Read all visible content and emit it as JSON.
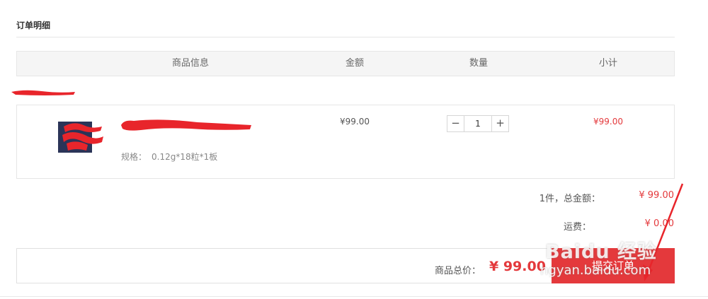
{
  "section": {
    "title": "订单明细"
  },
  "table": {
    "headers": {
      "product": "商品信息",
      "price": "金额",
      "quantity": "数量",
      "subtotal": "小计"
    }
  },
  "item": {
    "spec_label": "规格：",
    "spec_value": "0.12g*18粒*1板",
    "price": "¥99.00",
    "quantity": "1",
    "minus": "−",
    "plus": "+",
    "subtotal": "¥99.00"
  },
  "summary": {
    "count_label": "1件，总金额：",
    "total_amount": "¥ 99.00",
    "shipping_label": "运费：",
    "shipping_value": "¥ 0.00"
  },
  "footer": {
    "goods_total_label": "商品总价：",
    "goods_total_value": "¥ 99.00",
    "submit_label": "提交订单"
  },
  "watermark": {
    "logo": "Baidu 经验",
    "url": "ngyan.baidu.com"
  },
  "colors": {
    "accent": "#e4393c",
    "redaction": "#e8252b"
  }
}
